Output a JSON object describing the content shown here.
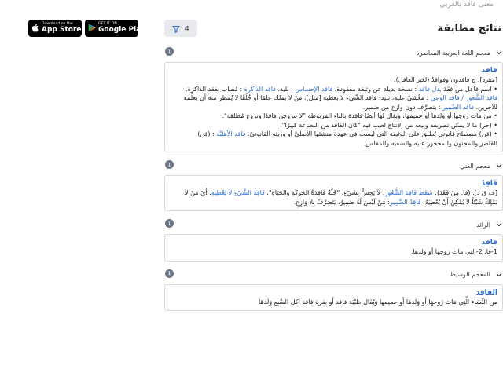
{
  "top_hint": "معنى فاقد بالعربي",
  "stores": {
    "apple": {
      "small": "Download on the",
      "big": "App Store"
    },
    "google": {
      "small": "GET IT ON",
      "big": "Google Play"
    }
  },
  "header": {
    "title": "نتائج مطابقة",
    "filter_count": "4"
  },
  "sections": [
    {
      "title": "معجم اللغة العربية المعاصرة",
      "count": "1",
      "word": "فاقد",
      "lines": [
        {
          "parts": [
            "[مفرد]: ج فاقدون وفواقدُ (لغير العاقل)."
          ]
        },
        {
          "parts": [
            "• اسم فاعل من فقَدَ ",
            {
              "link": "بدل فاقد"
            },
            " : نسخة بديلة عن وثيقة مفقودة. ",
            {
              "link": "فاقد الإحساس"
            },
            " : بليد. ",
            {
              "link": "فاقد الذاكرة"
            },
            " : مُصاب بفقد الذاكرة."
          ]
        },
        {
          "parts": [
            {
              "link": "فاقد الشُّعور / فاقد الوعي"
            },
            " : مَغْشيّ عليه، بليد- فاقد الشّيء لا يعطيه [مثل]: مَنْ لا يملك علمًا أو خُلُقًا لا يُنتظر منه أن يعلِّمه"
          ]
        },
        {
          "parts": [
            "للآخرين. ",
            {
              "link": "فاقد الضَّمير"
            },
            " : يتصرَّف دون وازع من ضمير."
          ]
        },
        {
          "parts": [
            "• من مات زوجها أو ولدها أو حميمها، ويقال لها أيضًا فاقدة بالتاء المربوطة \"لا تتزوجن فاقدًا وتزوج مُطلقة\"."
          ]
        },
        {
          "parts": [
            "• (جر) ما لا يمكن تصريفه وبيعه من الإنتاج لعيب فيه \"كان الفاقد من البضاعة كبيرًا\"."
          ]
        },
        {
          "parts": [
            "• (قن) مصطلح قانوني يُطلق على الوثيقة التي ليست في عهدة منشئها الأصليّ أو وريثه القانونيّ. ",
            {
              "link": "فاقد الأهليَّة"
            },
            " : (قن)"
          ]
        },
        {
          "parts": [
            "القاصر والمجنون والمحجور عليه والسفيه والمفلس."
          ]
        }
      ]
    },
    {
      "title": "معجم الغني",
      "count": "1",
      "word": "فَاقِدٌ",
      "lines": [
        {
          "parts": [
            "[ف ق د]. (فا. مِنْ فَقَدَ). ",
            {
              "link": "سَقَطَ فَاقِدَ الشُّعُورِ"
            },
            ": لاَ يَحِسُّ بِشَيْءٍ. \"جُثَّةٌ فَاقِدَةُ الحَرَكَةِ وَالحَيَاةِ\". ",
            {
              "link": "فَاقِدُ الشَّيْءِ لاَ يُعْطِيهِ"
            },
            ": أَيْ مَنْ لاَ"
          ]
        },
        {
          "parts": [
            "يَمْلِكُ شَيْئاً لاَ يُمْكِنُ أَنْ يُعْطِيَهُ. ",
            {
              "link": "فَاقِدُ الضَّمِيرِ"
            },
            ": مَنْ لَيْسَ لَهُ ضَمِيرٌ، يَتَصَرَّفُ بِلاَ وَازِعٍ."
          ]
        }
      ]
    },
    {
      "title": "الرائد",
      "count": "1",
      "word": "فاقد",
      "lines": [
        {
          "parts": [
            "1-فا. 2-التي مات زوجها أو ولدها."
          ]
        }
      ]
    },
    {
      "title": "المعجم الوسيط",
      "count": "1",
      "word": "الفاقد",
      "lines": [
        {
          "parts": [
            "من النِّسَاء الَّتِي مَاتَ زَوجهَا أَو وَلَدهَا أَو حميمها وَيُقَال ظَبْيَة فاقد أَو بقرة فاقد أكل السَّبع وَلَدهَا"
          ]
        }
      ]
    }
  ]
}
